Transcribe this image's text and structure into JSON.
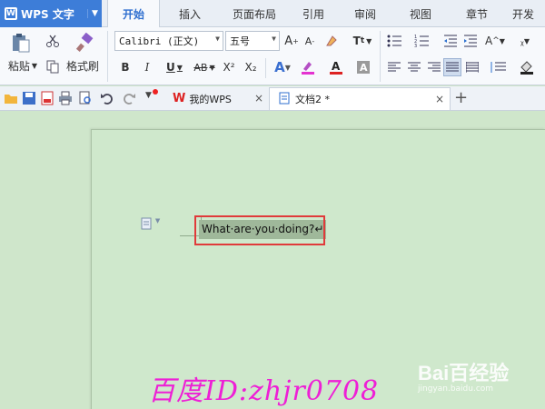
{
  "app": {
    "title": "WPS 文字"
  },
  "menu_tabs": [
    {
      "label": "开始",
      "active": true
    },
    {
      "label": "插入"
    },
    {
      "label": "页面布局"
    },
    {
      "label": "引用"
    },
    {
      "label": "审阅"
    },
    {
      "label": "视图"
    },
    {
      "label": "章节"
    },
    {
      "label": "开发"
    }
  ],
  "ribbon": {
    "paste_label": "粘贴",
    "format_painter_label": "格式刷",
    "font_name": "Calibri (正文)",
    "font_size": "五号",
    "bold": "B",
    "italic": "I",
    "underline": "U",
    "strike": "AB",
    "superscript": "X²",
    "subscript": "X₂"
  },
  "doc_tabs": [
    {
      "label": "我的WPS"
    },
    {
      "label": "文档2 *",
      "active": true
    }
  ],
  "document": {
    "text": "What·are·you·doing?↵"
  },
  "watermark": {
    "text": "百度ID:zhjr0708",
    "brand": "Bai百经验",
    "url": "jingyan.baidu.com"
  },
  "colors": {
    "accent": "#3d7dd8",
    "page_bg": "#cfe8cc",
    "highlight_border": "#e03a3a",
    "watermark": "#ee1fd6"
  }
}
